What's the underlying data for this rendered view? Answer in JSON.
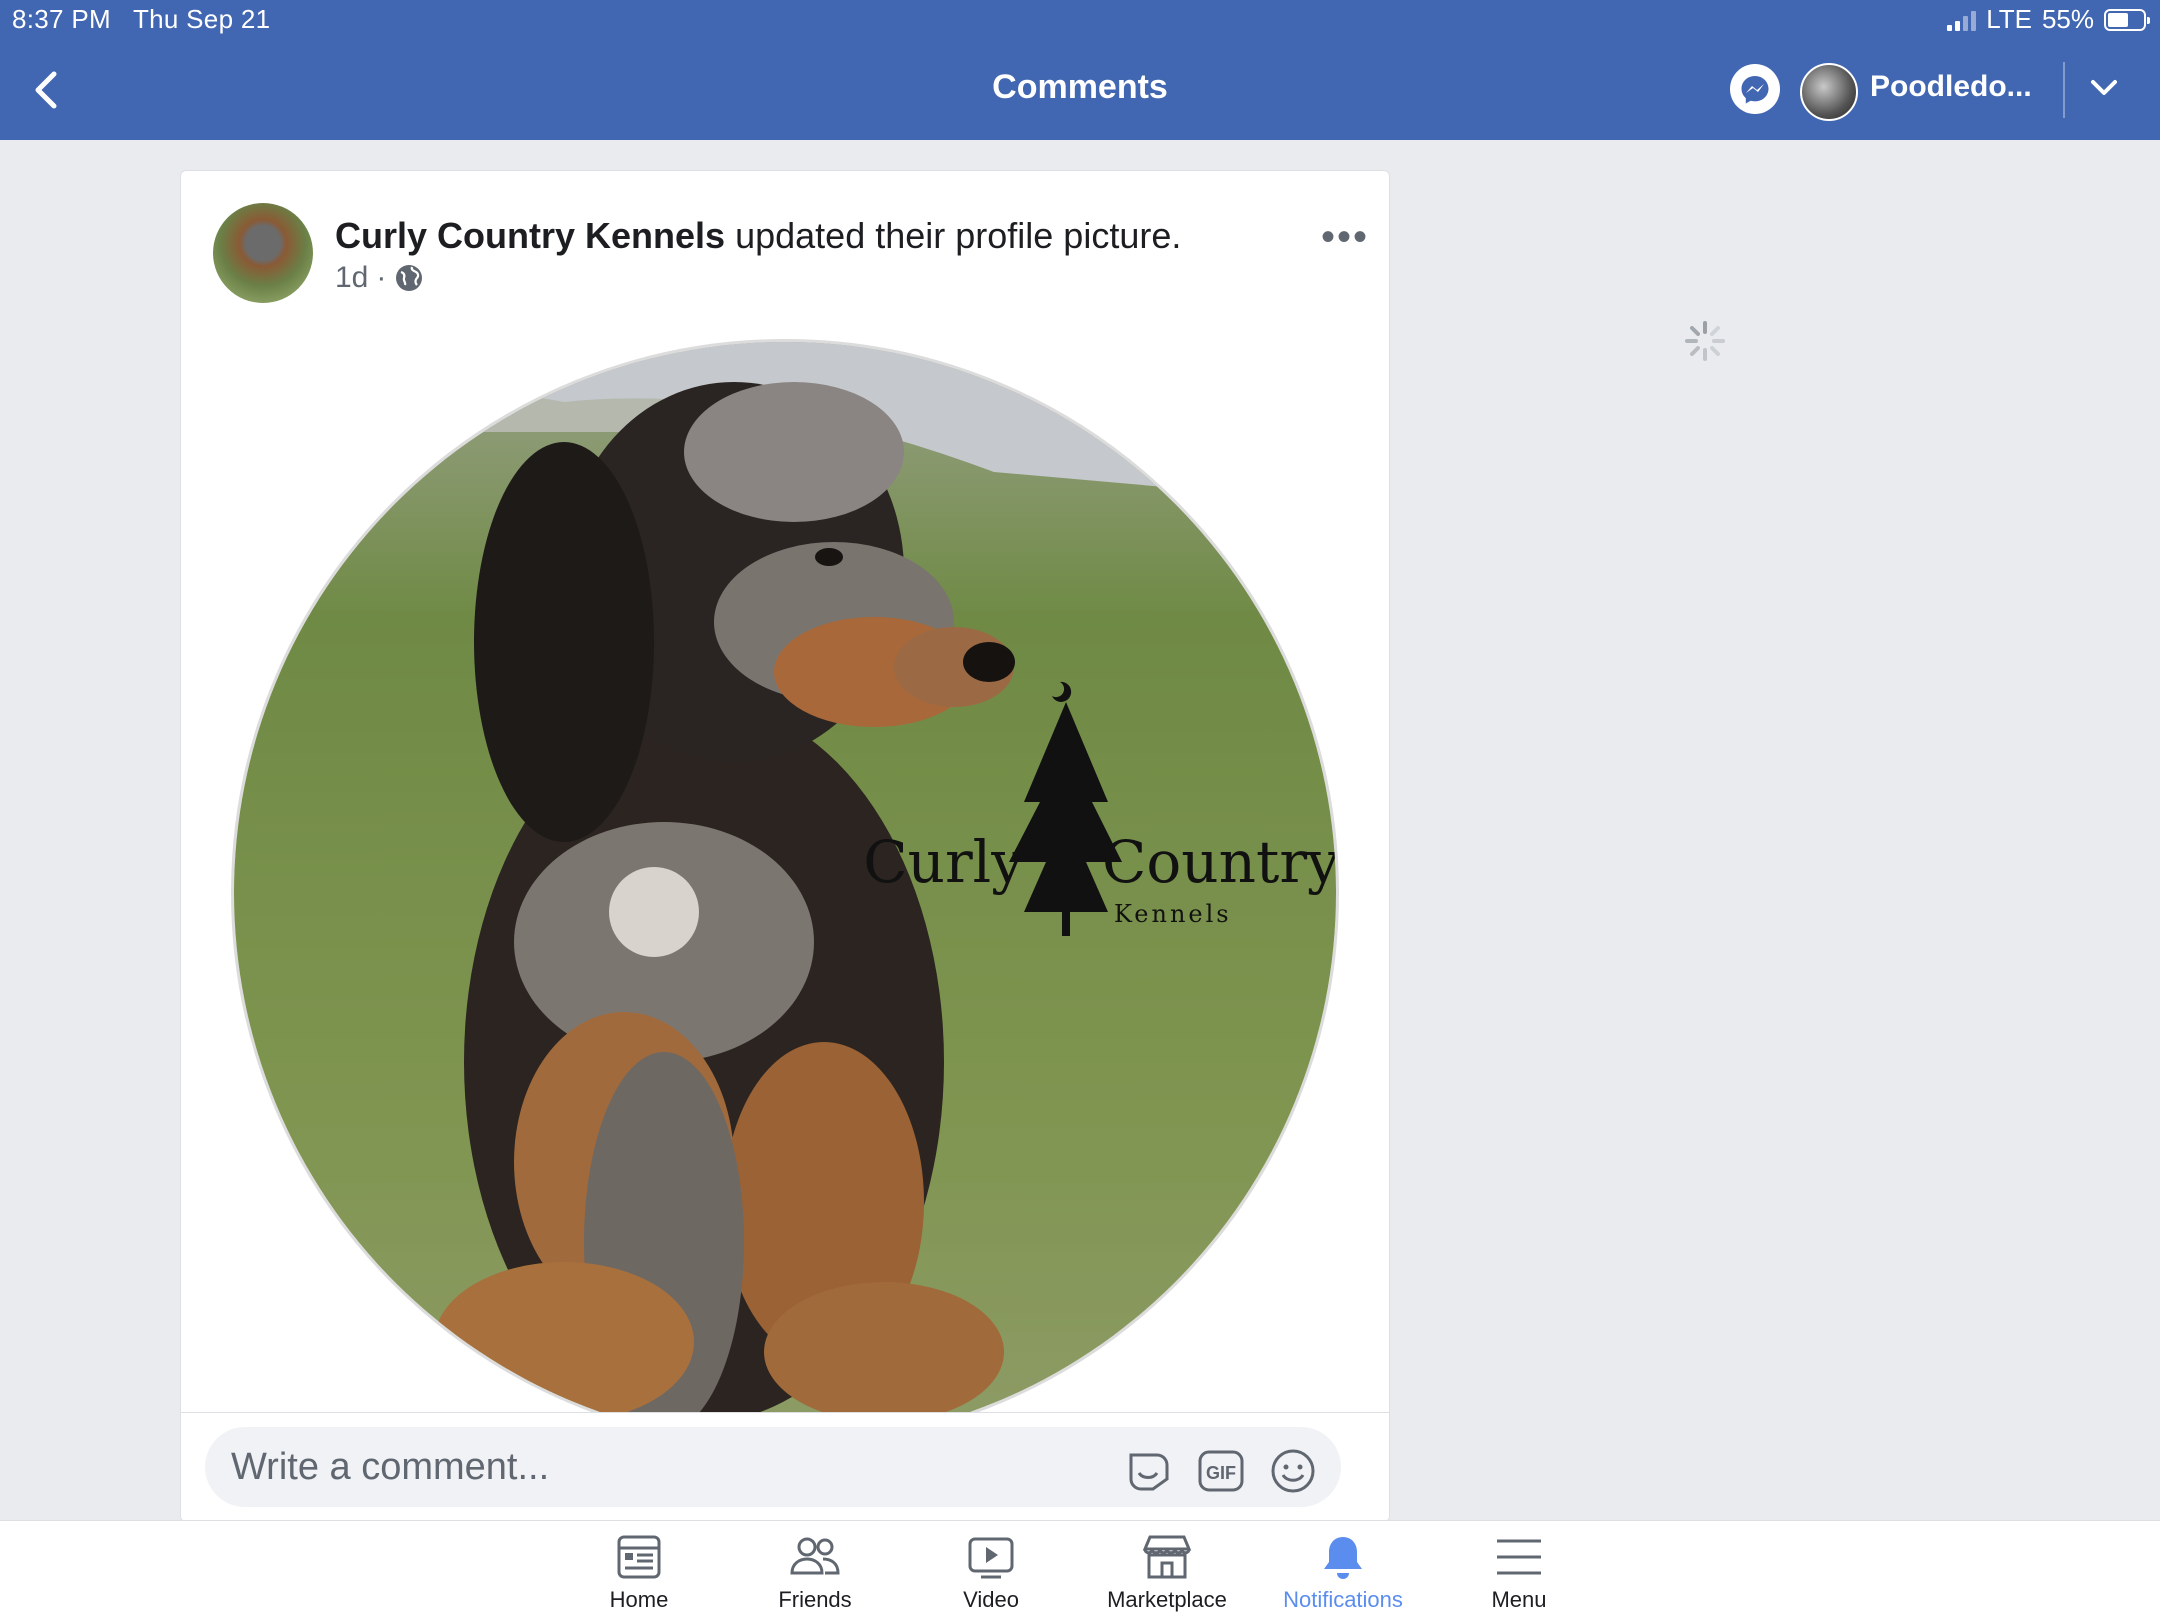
{
  "status_bar": {
    "time": "8:37 PM",
    "date": "Thu Sep 21",
    "network": "LTE",
    "battery": "55%"
  },
  "nav": {
    "title": "Comments",
    "account_name": "Poodledo..."
  },
  "post": {
    "author": "Curly Country Kennels",
    "action": "updated their profile picture.",
    "time": "1d",
    "separator": "·",
    "more": "•••",
    "image_watermark": {
      "line1a": "Curly",
      "line1b": "Country",
      "line2": "Kennels"
    }
  },
  "comment": {
    "placeholder": "Write a comment..."
  },
  "tabs": [
    {
      "label": "Home",
      "icon": "home-icon"
    },
    {
      "label": "Friends",
      "icon": "friends-icon"
    },
    {
      "label": "Video",
      "icon": "video-icon"
    },
    {
      "label": "Marketplace",
      "icon": "marketplace-icon"
    },
    {
      "label": "Notifications",
      "icon": "bell-icon",
      "active": true
    },
    {
      "label": "Menu",
      "icon": "hamburger-icon"
    }
  ],
  "colors": {
    "brand": "#4267b2",
    "active_tab": "#5b8def",
    "background": "#e9ebee"
  }
}
